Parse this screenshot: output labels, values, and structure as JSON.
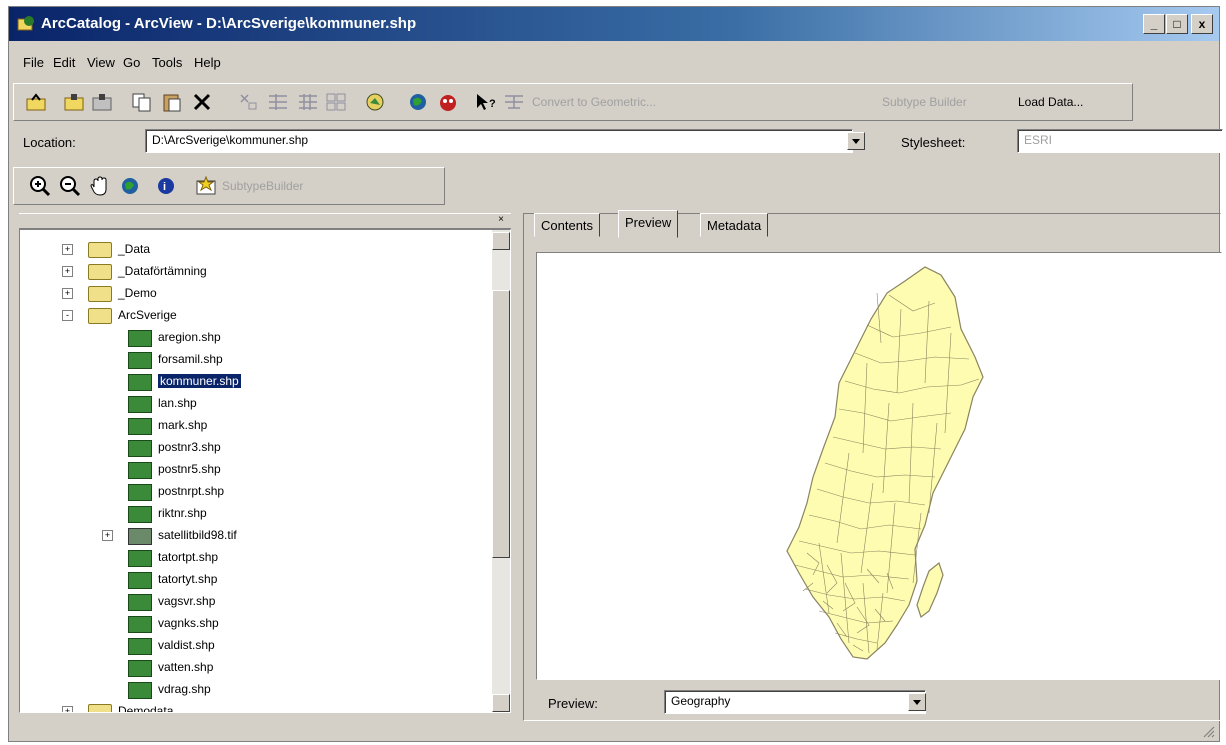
{
  "window": {
    "title": "ArcCatalog - ArcView - D:\\ArcSverige\\kommuner.shp",
    "controls": {
      "minimize": "_",
      "maximize": "□",
      "close": "x"
    }
  },
  "menu": [
    "File",
    "Edit",
    "View",
    "Go",
    "Tools",
    "Help"
  ],
  "toolbar": {
    "connect_to_geometric": "Convert to Geometric...",
    "subtype_builder": "Subtype Builder",
    "load_data": "Load Data..."
  },
  "location": {
    "label": "Location:",
    "value": "D:\\ArcSverige\\kommuner.shp"
  },
  "stylesheet": {
    "label": "Stylesheet:",
    "value": "ESRI"
  },
  "toolbar2": {
    "subtype_builder": "SubtypeBuilder"
  },
  "tree": {
    "items": [
      {
        "label": "_Data",
        "type": "folder",
        "level": 1,
        "expander": "+"
      },
      {
        "label": "_Dataförtämning",
        "type": "folder",
        "level": 1,
        "expander": "+"
      },
      {
        "label": "_Demo",
        "type": "folder",
        "level": 1,
        "expander": "+"
      },
      {
        "label": "ArcSverige",
        "type": "folder",
        "level": 1,
        "expander": "-"
      },
      {
        "label": "aregion.shp",
        "type": "shp",
        "level": 2
      },
      {
        "label": "forsamil.shp",
        "type": "shp",
        "level": 2
      },
      {
        "label": "kommuner.shp",
        "type": "shp",
        "level": 2,
        "selected": true
      },
      {
        "label": "lan.shp",
        "type": "shp",
        "level": 2
      },
      {
        "label": "mark.shp",
        "type": "shp",
        "level": 2
      },
      {
        "label": "postnr3.shp",
        "type": "shp",
        "level": 2
      },
      {
        "label": "postnr5.shp",
        "type": "shp",
        "level": 2
      },
      {
        "label": "postnrpt.shp",
        "type": "shp",
        "level": 2
      },
      {
        "label": "riktnr.shp",
        "type": "shp",
        "level": 2
      },
      {
        "label": "satellitbild98.tif",
        "type": "raster",
        "level": 2,
        "expander": "+"
      },
      {
        "label": "tatortpt.shp",
        "type": "shp",
        "level": 2
      },
      {
        "label": "tatortyt.shp",
        "type": "shp",
        "level": 2
      },
      {
        "label": "vagsvr.shp",
        "type": "shp",
        "level": 2
      },
      {
        "label": "vagnks.shp",
        "type": "shp",
        "level": 2
      },
      {
        "label": "valdist.shp",
        "type": "shp",
        "level": 2
      },
      {
        "label": "vatten.shp",
        "type": "shp",
        "level": 2
      },
      {
        "label": "vdrag.shp",
        "type": "shp",
        "level": 2
      },
      {
        "label": "Demodata",
        "type": "folder",
        "level": 1,
        "expander": "+"
      }
    ]
  },
  "tabs": [
    {
      "label": "Contents",
      "active": false
    },
    {
      "label": "Preview",
      "active": true
    },
    {
      "label": "Metadata",
      "active": false
    }
  ],
  "preview": {
    "label": "Preview:",
    "value": "Geography"
  },
  "colors": {
    "window_bg": "#d4d0c8",
    "title_gradient_start": "#0a246a",
    "map_fill": "#fdfcb0",
    "map_stroke": "#8a8460",
    "selection_bg": "#0a246a"
  }
}
